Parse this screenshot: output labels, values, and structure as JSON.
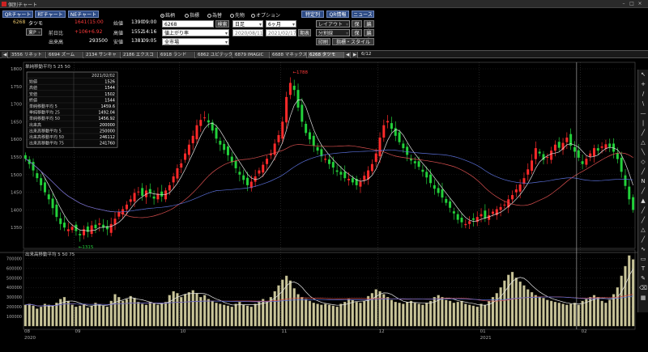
{
  "window": {
    "title": "個別チャート"
  },
  "toolbar": {
    "qr_chart": "QRチャート",
    "rt_chart": "RTチャート",
    "ne_chart": "NEチャート",
    "stock_code": "6268",
    "stock_name": "タツモ",
    "market": "東P",
    "market_note": "",
    "price": "1641",
    "price_time": "(15:00",
    "prev_label": "前日比",
    "change": "+106",
    "change_pct": "+6.92",
    "volume_label": "出来高",
    "volume": "293500",
    "open_label": "始値",
    "open": "1390",
    "open_time": "09:00",
    "high_label": "高値",
    "high": "1552",
    "high_time": "14:16",
    "low_label": "安値",
    "low": "1381",
    "low_time": "09:05"
  },
  "modes": {
    "options": [
      "銘柄",
      "指標",
      "為替",
      "先物",
      "オプション"
    ],
    "selected": 0
  },
  "controls": {
    "code_field": "6268",
    "search": "検索",
    "ranking": "値上がり率",
    "scope": "全市場",
    "period": "日足",
    "range": "6ヶ月",
    "date_from": "2020/08/11",
    "date_to": "2021/02/17",
    "apply": "期表",
    "favorite": "特定列",
    "qr_info": "QR情報",
    "news": "ニュース",
    "layout": "レイアウト",
    "save1": "保存",
    "edit1": "編集",
    "split": "分割線",
    "save2": "保存",
    "edit2": "編集",
    "print": "印刷",
    "indicator_style": "指標・スタイル"
  },
  "tabs": [
    "3556 リネット",
    "6694 ズーム",
    "2134 サンキャ",
    "2186 エクスコ",
    "6918 ランド",
    "6862 ユビテック",
    "6879 IMAGIC",
    "6688 マネックスG",
    "6268 タツモ"
  ],
  "tab_active": 8,
  "tab_page": "6/12",
  "info_box": {
    "date": "2021/02/02",
    "rows": [
      [
        "始値",
        "1526"
      ],
      [
        "高値",
        "1544"
      ],
      [
        "安値",
        "1502"
      ],
      [
        "終値",
        "1544"
      ],
      [
        "単純移動平均 5",
        "1459.6"
      ],
      [
        "単純移動平均 25",
        "1492.04"
      ],
      [
        "単純移動平均 50",
        "1456.92"
      ],
      [
        "出来高",
        "200000"
      ],
      [
        "出来高移動平均 5",
        "250000"
      ],
      [
        "出来高移動平均 50",
        "246112"
      ],
      [
        "出来高移動平均 75",
        "241760"
      ]
    ]
  },
  "chart_data": {
    "type": "candlestick",
    "price_legend": {
      "title": "単純移動平均",
      "periods": [
        "5",
        "25",
        "50"
      ]
    },
    "volume_legend": {
      "title": "出来高移動平均",
      "periods": [
        "5",
        "50",
        "75"
      ]
    },
    "price_ticks": [
      "1800",
      "1750",
      "1700",
      "1650",
      "1600",
      "1550",
      "1500",
      "1450",
      "1400",
      "1350"
    ],
    "price_ylim": [
      1300,
      1800
    ],
    "volume_ticks": [
      "700000",
      "600000",
      "500000",
      "400000",
      "300000",
      "200000",
      "100000"
    ],
    "volume_ylim": [
      0,
      720000
    ],
    "month_labels": [
      "08",
      "09",
      "10",
      "11",
      "12",
      "01",
      "02"
    ],
    "year_labels": [
      "2020",
      "2021"
    ],
    "annotations": [
      {
        "text": "1788",
        "type": "high"
      },
      {
        "text": "1315",
        "type": "low"
      }
    ],
    "closes": [
      1545,
      1530,
      1512,
      1490,
      1470,
      1450,
      1430,
      1405,
      1380,
      1360,
      1350,
      1345,
      1352,
      1340,
      1328,
      1345,
      1338,
      1356,
      1348,
      1362,
      1350,
      1345,
      1360,
      1375,
      1395,
      1402,
      1415,
      1430,
      1448,
      1452,
      1440,
      1455,
      1448,
      1432,
      1446,
      1438,
      1455,
      1470,
      1495,
      1518,
      1532,
      1560,
      1585,
      1610,
      1640,
      1655,
      1662,
      1648,
      1625,
      1602,
      1585,
      1570,
      1555,
      1535,
      1518,
      1500,
      1485,
      1470,
      1480,
      1495,
      1512,
      1528,
      1545,
      1560,
      1588,
      1612,
      1650,
      1720,
      1760,
      1740,
      1690,
      1650,
      1618,
      1600,
      1582,
      1568,
      1552,
      1545,
      1530,
      1520,
      1508,
      1500,
      1490,
      1488,
      1478,
      1470,
      1480,
      1497,
      1512,
      1530,
      1560,
      1605,
      1640,
      1652,
      1630,
      1610,
      1592,
      1575,
      1556,
      1540,
      1532,
      1522,
      1508,
      1492,
      1476,
      1460,
      1448,
      1435,
      1420,
      1406,
      1390,
      1372,
      1365,
      1360,
      1368,
      1372,
      1380,
      1388,
      1376,
      1385,
      1395,
      1402,
      1408,
      1415,
      1430,
      1442,
      1458,
      1472,
      1490,
      1515,
      1540,
      1575,
      1560,
      1542,
      1550,
      1568,
      1585,
      1576,
      1590,
      1605,
      1582,
      1565,
      1548,
      1530,
      1545,
      1560,
      1575,
      1568,
      1580,
      1586,
      1578,
      1565,
      1544,
      1508,
      1468,
      1430,
      1400
    ],
    "volumes": [
      220000,
      230000,
      210000,
      180000,
      200000,
      230000,
      220000,
      210000,
      240000,
      280000,
      300000,
      260000,
      220000,
      200000,
      210000,
      230000,
      190000,
      210000,
      240000,
      220000,
      210000,
      200000,
      260000,
      330000,
      300000,
      260000,
      280000,
      310000,
      290000,
      250000,
      230000,
      220000,
      250000,
      240000,
      220000,
      230000,
      250000,
      320000,
      360000,
      340000,
      300000,
      330000,
      350000,
      370000,
      340000,
      300000,
      320000,
      280000,
      260000,
      240000,
      230000,
      220000,
      210000,
      200000,
      230000,
      250000,
      220000,
      210000,
      200000,
      230000,
      260000,
      280000,
      250000,
      300000,
      360000,
      420000,
      480000,
      520000,
      470000,
      390000,
      330000,
      300000,
      280000,
      260000,
      240000,
      230000,
      220000,
      230000,
      220000,
      210000,
      200000,
      230000,
      250000,
      280000,
      270000,
      250000,
      240000,
      260000,
      310000,
      340000,
      380000,
      360000,
      330000,
      300000,
      270000,
      250000,
      240000,
      230000,
      250000,
      260000,
      240000,
      230000,
      220000,
      240000,
      260000,
      300000,
      320000,
      300000,
      270000,
      260000,
      240000,
      250000,
      260000,
      230000,
      220000,
      210000,
      200000,
      230000,
      220000,
      260000,
      300000,
      340000,
      400000,
      470000,
      530000,
      560000,
      500000,
      460000,
      420000,
      380000,
      350000,
      320000,
      300000,
      290000,
      270000,
      260000,
      250000,
      240000,
      230000,
      220000,
      230000,
      240000,
      220000,
      260000,
      280000,
      300000,
      320000,
      300000,
      260000,
      240000,
      270000,
      330000,
      400000,
      520000,
      620000,
      730000,
      690000
    ]
  },
  "tools": [
    "↖",
    "+",
    "/",
    "\\",
    "—",
    "|",
    "╱",
    "△",
    "╲",
    "◇",
    "╱",
    "N",
    "╱",
    "▲",
    "╱",
    "╱",
    "△",
    "╱",
    "∿",
    "▭",
    "T",
    "✎",
    "⌫",
    "▦"
  ]
}
